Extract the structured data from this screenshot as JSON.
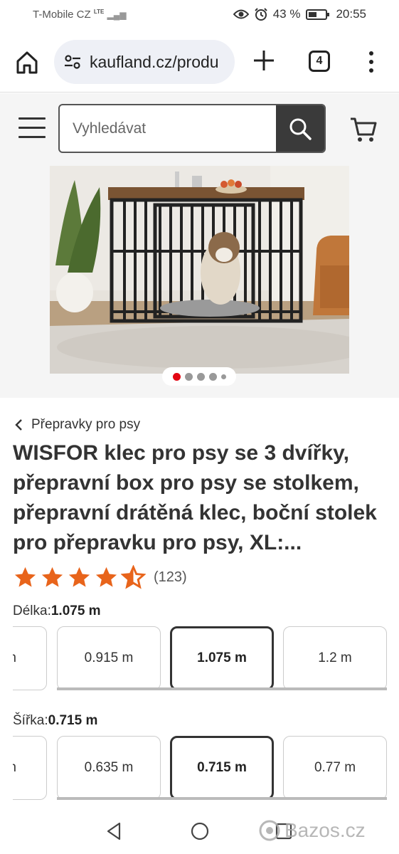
{
  "status_bar": {
    "carrier": "T-Mobile CZ",
    "network": "LTE",
    "battery": "43 %",
    "time": "20:55"
  },
  "browser": {
    "url": "kaufland.cz/produ",
    "tab_count": "4"
  },
  "header": {
    "search_placeholder": "Vyhledávat"
  },
  "gallery": {
    "image_count": 5,
    "active_index": 0
  },
  "product": {
    "breadcrumb": "Přepravky pro psy",
    "title": "WISFOR klec pro psy se 3 dvířky, přepravní box pro psy se stolkem, přepravní drátěná klec, boční stolek pro přepravku pro psy, XL:...",
    "rating": 4.5,
    "rating_count": "(123)",
    "rating_color": "#e8641b"
  },
  "options": {
    "length": {
      "label": "Délka:",
      "selected": "1.075 m",
      "values": [
        "m",
        "0.915 m",
        "1.075 m",
        "1.2 m"
      ]
    },
    "width": {
      "label": "Šířka:",
      "selected": "0.715 m",
      "values": [
        "m",
        "0.635 m",
        "0.715 m",
        "0.77 m"
      ]
    }
  },
  "watermark": "Bazos.cz"
}
